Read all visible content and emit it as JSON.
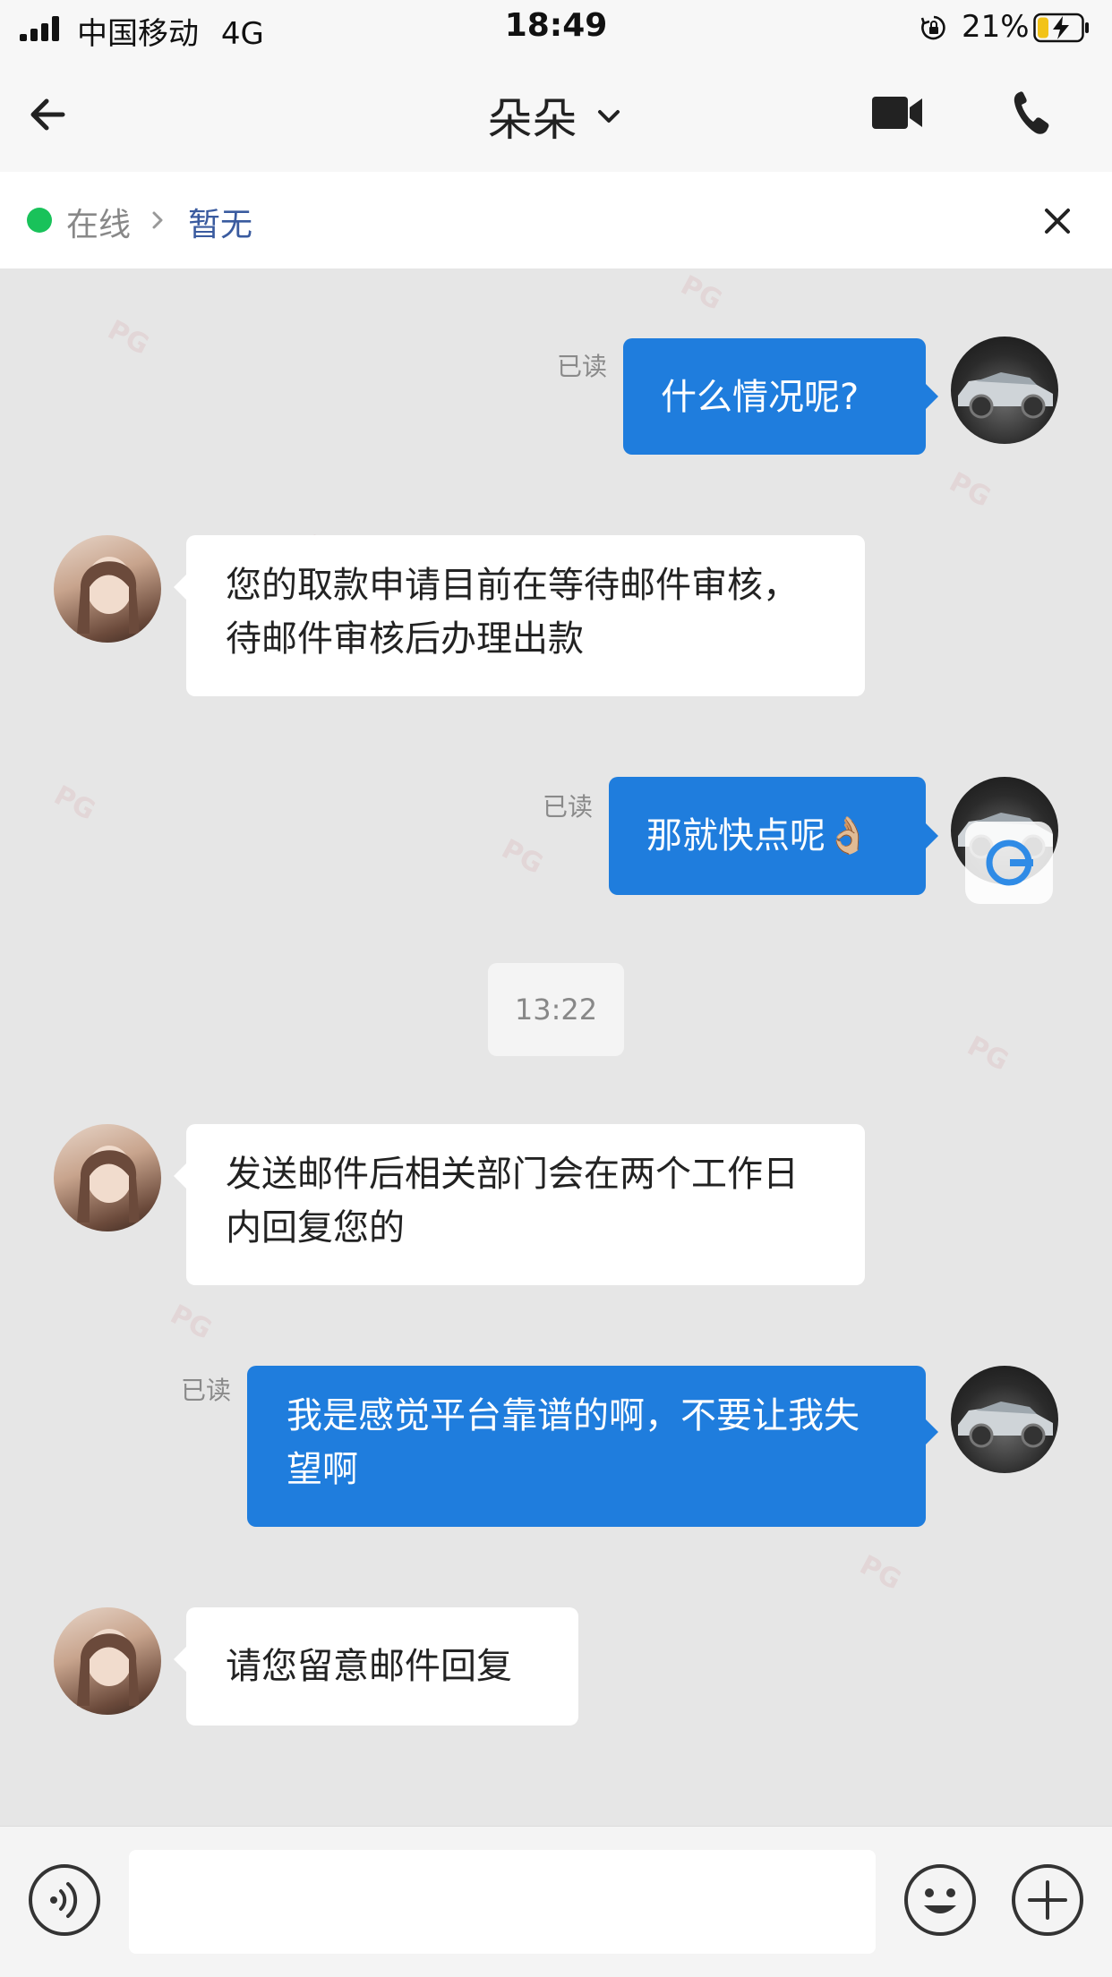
{
  "status_bar": {
    "carrier": "中国移动",
    "network": "4G",
    "time": "18:49",
    "battery_percent": "21%",
    "icons": [
      "signal-icon",
      "rotation-lock-icon",
      "battery-charging-icon"
    ]
  },
  "nav": {
    "title": "朵朵",
    "icons": [
      "back-arrow-icon",
      "chevron-down-icon",
      "video-camera-icon",
      "phone-icon"
    ]
  },
  "contact_status": {
    "online_label": "在线",
    "value": "暂无",
    "online_color": "#19c25a",
    "icons": [
      "chevron-right-icon",
      "close-icon"
    ]
  },
  "messages": [
    {
      "direction": "out",
      "text": "什么情况呢?",
      "read_label": "已读"
    },
    {
      "direction": "in",
      "text": "您的取款申请目前在等待邮件审核，待邮件审核后办理出款"
    },
    {
      "direction": "out",
      "text": "那就快点呢👌🏼",
      "read_label": "已读"
    },
    {
      "type": "timestamp",
      "text": "13:22"
    },
    {
      "direction": "in",
      "text": "发送邮件后相关部门会在两个工作日内回复您的"
    },
    {
      "direction": "out",
      "text": "我是感觉平台靠谱的啊，不要让我失望啊",
      "read_label": "已读"
    },
    {
      "direction": "in",
      "text": "请您留意邮件回复"
    }
  ],
  "input_bar": {
    "placeholder": "",
    "icons": [
      "voice-icon",
      "emoji-icon",
      "plus-icon"
    ]
  },
  "colors": {
    "outgoing_bubble": "#1f7ddd",
    "incoming_bubble": "#ffffff",
    "chat_background": "#e6e6e6",
    "link_blue": "#3a5b9f"
  }
}
